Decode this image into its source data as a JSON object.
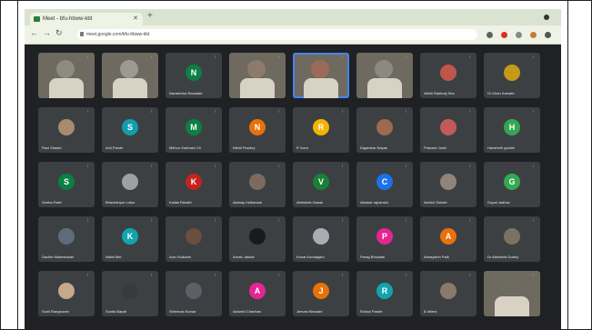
{
  "tab": {
    "title": "Meet - bfu-hbww-kbt"
  },
  "address_bar": {
    "url": "meet.google.com/bfu-hbww-kbt"
  },
  "colors": {
    "accent": "#4285f4",
    "tile_bg": "#3c4043",
    "stage_bg": "#202124"
  },
  "participants": [
    {
      "name": "",
      "avatar": "photo",
      "color": "#8b8b80"
    },
    {
      "name": "",
      "avatar": "photo",
      "color": "#9a9a92"
    },
    {
      "name": "Narasimha Ramaiah",
      "avatar": "N",
      "color": "#0b8043"
    },
    {
      "name": "",
      "avatar": "photo",
      "color": "#8c7a6a"
    },
    {
      "name": "",
      "avatar": "photo",
      "color": "#9d6a5a",
      "active": true
    },
    {
      "name": "",
      "avatar": "photo",
      "color": "#8a8a82"
    },
    {
      "name": "Nikhil Rakhvaj Sha",
      "avatar": "photo",
      "color": "#c0564b"
    },
    {
      "name": "Dr Kiran Kamath",
      "avatar": "photo",
      "color": "#c49a1a"
    },
    {
      "name": "Ravi Shastri",
      "avatar": "photo",
      "color": "#a88a70"
    },
    {
      "name": "Anil Pande",
      "avatar": "S",
      "color": "#129eaf"
    },
    {
      "name": "Mithun Subhash Ch",
      "avatar": "M",
      "color": "#0b8043"
    },
    {
      "name": "Nikhil Pandey",
      "avatar": "N",
      "color": "#e8710a"
    },
    {
      "name": "R Suvir",
      "avatar": "R",
      "color": "#f4b400"
    },
    {
      "name": "Digambar Nayak",
      "avatar": "photo",
      "color": "#9e6a4e"
    },
    {
      "name": "Prakash Joshi",
      "avatar": "photo",
      "color": "#c25a5a"
    },
    {
      "name": "Harishcftr guvilal",
      "avatar": "H",
      "color": "#33a853"
    },
    {
      "name": "Sneha Patel",
      "avatar": "S",
      "color": "#0b8043"
    },
    {
      "name": "Bhaveshpur Lotus",
      "avatar": "photo",
      "color": "#9ea0a4"
    },
    {
      "name": "Kailas Ravath",
      "avatar": "K",
      "color": "#c5221f"
    },
    {
      "name": "Akshay Kelkarwar",
      "avatar": "photo",
      "color": "#7c6a5e"
    },
    {
      "name": "Abhishek Gawai",
      "avatar": "V",
      "color": "#188038"
    },
    {
      "name": "Alankar rajvanshi",
      "avatar": "C",
      "color": "#1a73e8"
    },
    {
      "name": "Ashish Shinde",
      "avatar": "photo",
      "color": "#8f857a"
    },
    {
      "name": "Gopal Jadhav",
      "avatar": "G",
      "color": "#34a853"
    },
    {
      "name": "Sachin Maheshwari",
      "avatar": "photo",
      "color": "#5f6b7a"
    },
    {
      "name": "Nikhil Mel",
      "avatar": "K",
      "color": "#12a4af"
    },
    {
      "name": "Arun Kulkarni",
      "avatar": "photo",
      "color": "#6a4e3e"
    },
    {
      "name": "Arnab Jakhar",
      "avatar": "photo",
      "color": "#1a1a1a"
    },
    {
      "name": "Kunal Kumalgaru",
      "avatar": "photo",
      "color": "#a9adb3"
    },
    {
      "name": "Parag Bhuwale",
      "avatar": "P",
      "color": "#e52592"
    },
    {
      "name": "Abhaysinh Patil",
      "avatar": "A",
      "color": "#e8710a"
    },
    {
      "name": "Dr Abhishek Dubey",
      "avatar": "photo",
      "color": "#7b7360"
    },
    {
      "name": "Sunil Ranghuran",
      "avatar": "photo",
      "color": "#c6a98a"
    },
    {
      "name": "Sunita Bapat",
      "avatar": "photo",
      "color": "#3a3a3a"
    },
    {
      "name": "Shrinivas Kumar",
      "avatar": "photo",
      "color": "#5e5e66"
    },
    {
      "name": "Ashwini Chavhan",
      "avatar": "A",
      "color": "#e52592"
    },
    {
      "name": "Jeevan Bhosale",
      "avatar": "J",
      "color": "#e8710a"
    },
    {
      "name": "Rohan Pande",
      "avatar": "R",
      "color": "#12a4af"
    },
    {
      "name": "8 others",
      "avatar": "photo",
      "color": "#8a7a6a"
    },
    {
      "name": "",
      "avatar": "photo",
      "color": "#6c6c60",
      "video": true
    }
  ]
}
